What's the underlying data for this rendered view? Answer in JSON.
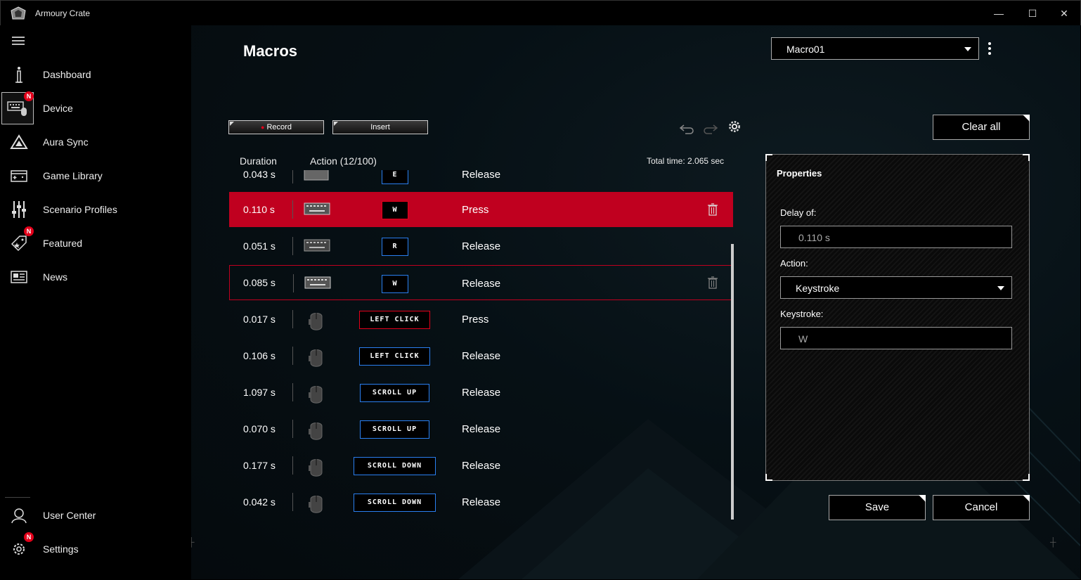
{
  "window": {
    "title": "Armoury Crate",
    "minimize": "—",
    "maximize": "☐",
    "close": "✕"
  },
  "sidebar": {
    "items": [
      {
        "label": "Dashboard",
        "icon": "dashboard-icon"
      },
      {
        "label": "Device",
        "icon": "keyboard-mouse-icon",
        "badge": "N"
      },
      {
        "label": "Aura Sync",
        "icon": "aura-triangle-icon"
      },
      {
        "label": "Game Library",
        "icon": "game-library-icon"
      },
      {
        "label": "Scenario Profiles",
        "icon": "sliders-icon"
      },
      {
        "label": "Featured",
        "icon": "tag-icon",
        "badge": "N"
      },
      {
        "label": "News",
        "icon": "news-icon"
      }
    ],
    "bottom": [
      {
        "label": "User Center",
        "icon": "user-icon"
      },
      {
        "label": "Settings",
        "icon": "gear-icon",
        "badge": "N"
      }
    ]
  },
  "header": {
    "title": "Macros",
    "macro_select": "Macro01"
  },
  "toolbar": {
    "record": "Record",
    "insert": "Insert",
    "clear_all": "Clear all"
  },
  "table": {
    "col_duration": "Duration",
    "col_action": "Action (12/100)",
    "total_time": "Total time: 2.065 sec",
    "rows": [
      {
        "duration": "0.043 s",
        "device": "keyboard",
        "key": "E",
        "action": "Release"
      },
      {
        "duration": "0.110 s",
        "device": "keyboard",
        "key": "W",
        "action": "Press"
      },
      {
        "duration": "0.051 s",
        "device": "keyboard",
        "key": "R",
        "action": "Release"
      },
      {
        "duration": "0.085 s",
        "device": "keyboard",
        "key": "W",
        "action": "Release"
      },
      {
        "duration": "0.017 s",
        "device": "mouse",
        "key": "LEFT CLICK",
        "action": "Press"
      },
      {
        "duration": "0.106 s",
        "device": "mouse",
        "key": "LEFT CLICK",
        "action": "Release"
      },
      {
        "duration": "1.097 s",
        "device": "mouse",
        "key": "SCROLL UP",
        "action": "Release"
      },
      {
        "duration": "0.070 s",
        "device": "mouse",
        "key": "SCROLL UP",
        "action": "Release"
      },
      {
        "duration": "0.177 s",
        "device": "mouse",
        "key": "SCROLL DOWN",
        "action": "Release"
      },
      {
        "duration": "0.042 s",
        "device": "mouse",
        "key": "SCROLL DOWN",
        "action": "Release"
      }
    ]
  },
  "properties": {
    "title": "Properties",
    "delay_label": "Delay of:",
    "delay_value": "0.110 s",
    "action_label": "Action:",
    "action_value": "Keystroke",
    "keystroke_label": "Keystroke:",
    "keystroke_value": "W"
  },
  "footer": {
    "save": "Save",
    "cancel": "Cancel"
  },
  "colors": {
    "accent_red": "#c0001f",
    "key_border_blue": "#2a7ff0",
    "badge_red": "#e2001a"
  }
}
